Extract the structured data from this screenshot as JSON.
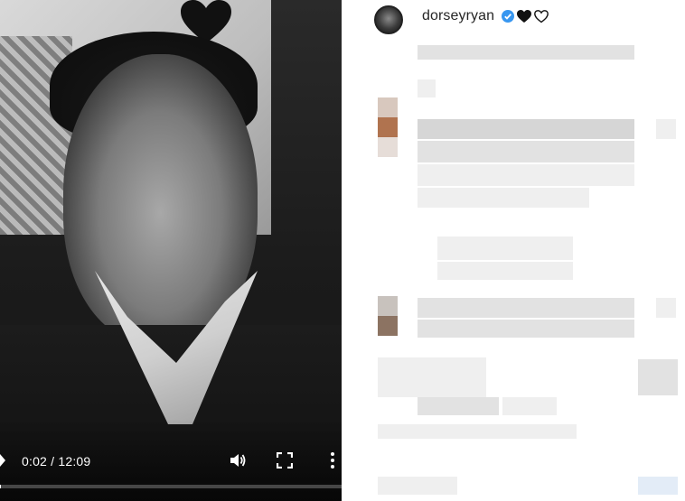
{
  "video": {
    "time_current": "0:02",
    "time_total": "12:09",
    "time_separator": " / ",
    "progress": 0.003,
    "colors": {
      "controls": "#ffffff",
      "track": "#5a5a5a"
    },
    "icons": [
      "play-icon",
      "volume-icon",
      "fullscreen-icon",
      "more-vertical-icon"
    ]
  },
  "post": {
    "username": "dorseyryan",
    "badges": [
      "verified-icon",
      "black-heart-icon",
      "white-heart-icon"
    ],
    "colors": {
      "verified": "#3897f0",
      "text": "#262626"
    }
  }
}
